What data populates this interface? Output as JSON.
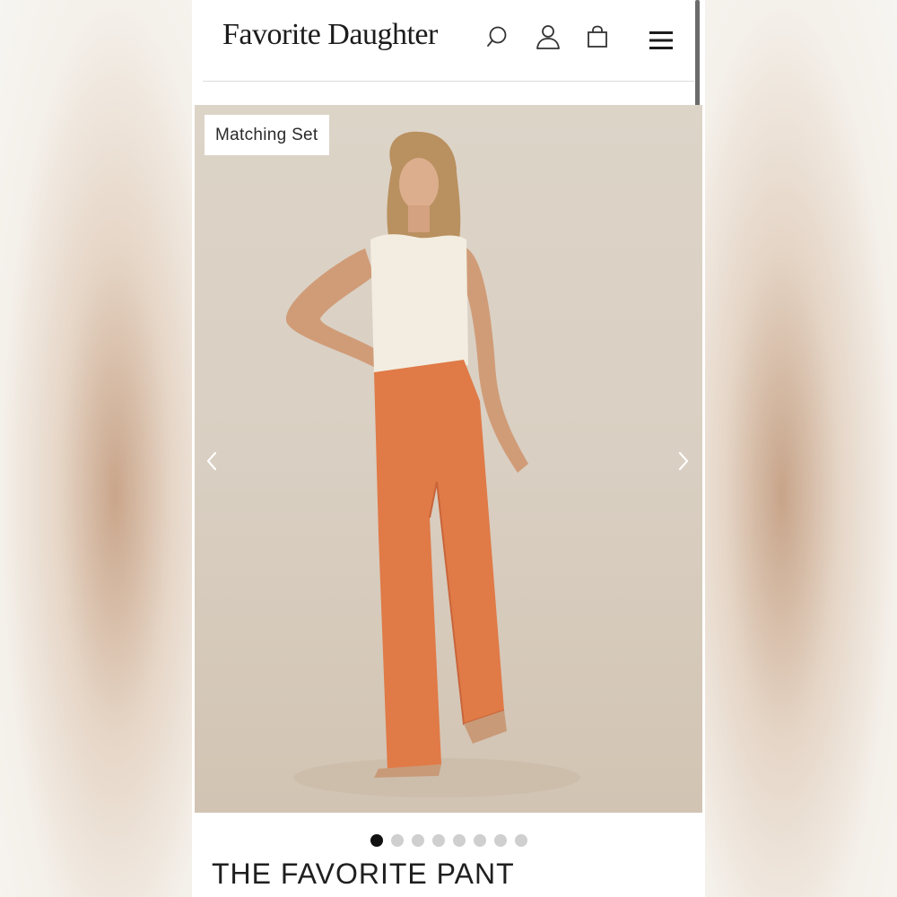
{
  "header": {
    "brand": "Favorite Daughter",
    "icons": [
      "search-icon",
      "account-icon",
      "bag-icon",
      "menu-icon"
    ]
  },
  "product": {
    "badge": "Matching Set",
    "title": "THE FAVORITE PANT",
    "gallery": {
      "image_count": 8,
      "active_index": 0
    }
  },
  "colors": {
    "background": "#ffffff",
    "text": "#1f1f1f",
    "pant": "#e07a47",
    "top": "#f2ede0",
    "hero_bg": "#d9cfc2",
    "dot_inactive": "#cfcfcf",
    "dot_active": "#111111"
  }
}
